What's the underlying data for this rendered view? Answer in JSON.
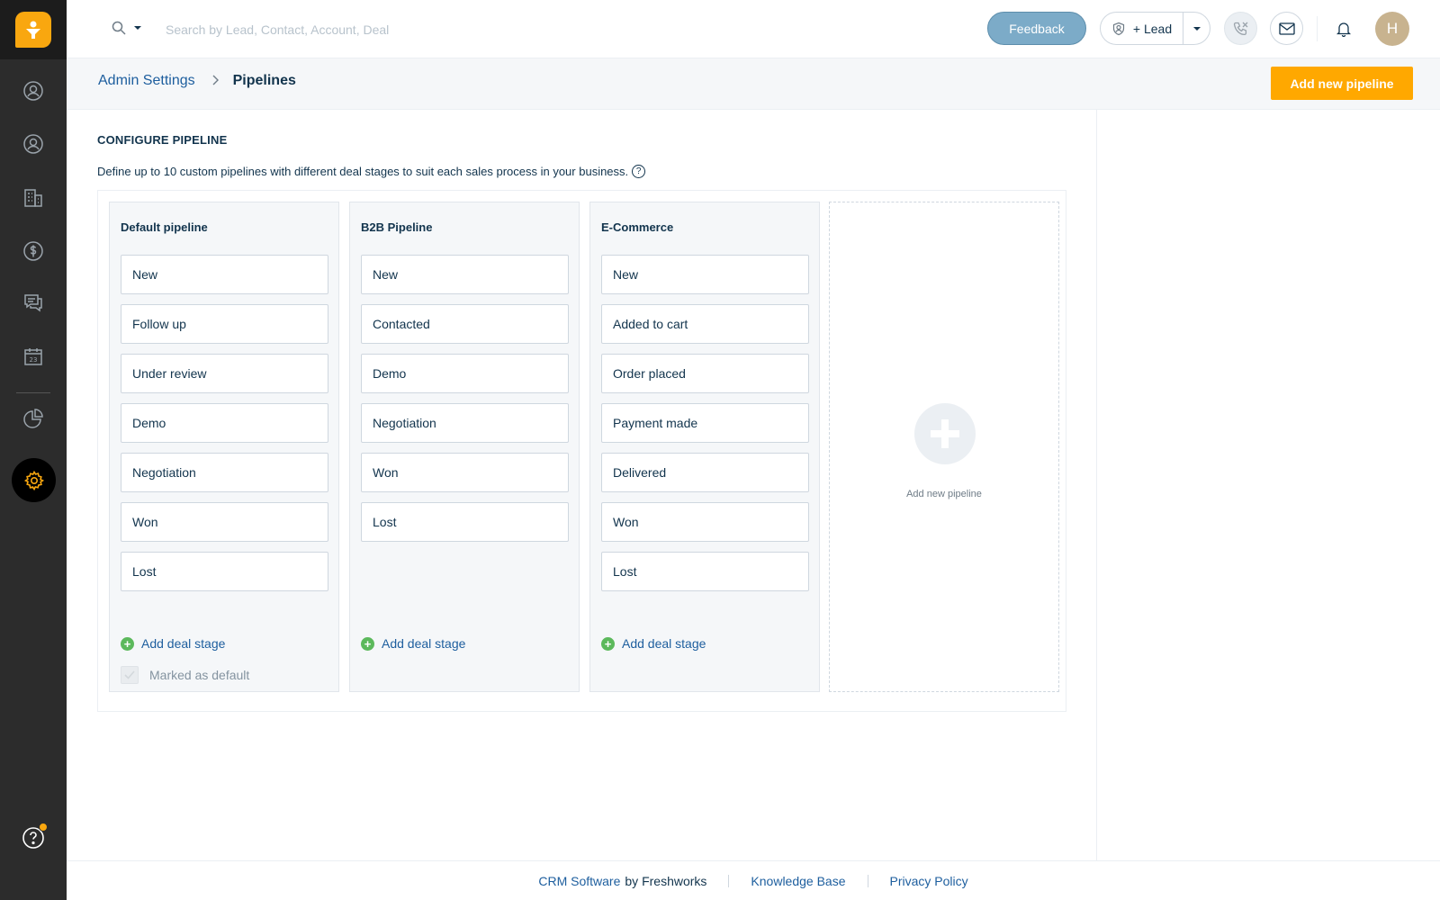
{
  "search": {
    "placeholder": "Search by Lead, Contact, Account, Deal"
  },
  "topbar": {
    "feedback_label": "Feedback",
    "lead_label": "+ Lead",
    "avatar_initial": "H"
  },
  "breadcrumb": {
    "parent": "Admin Settings",
    "current": "Pipelines"
  },
  "header": {
    "add_pipeline_label": "Add new pipeline"
  },
  "section": {
    "title": "CONFIGURE PIPELINE",
    "description": "Define up to 10 custom pipelines with different deal stages to suit each sales process in your business."
  },
  "pipelines": [
    {
      "name": "Default pipeline",
      "stages": [
        "New",
        "Follow up",
        "Under review",
        "Demo",
        "Negotiation",
        "Won",
        "Lost"
      ],
      "add_stage_label": "Add deal stage",
      "default_label": "Marked as default"
    },
    {
      "name": "B2B Pipeline",
      "stages": [
        "New",
        "Contacted",
        "Demo",
        "Negotiation",
        "Won",
        "Lost"
      ],
      "add_stage_label": "Add deal stage"
    },
    {
      "name": "E-Commerce",
      "stages": [
        "New",
        "Added to cart",
        "Order placed",
        "Payment made",
        "Delivered",
        "Won",
        "Lost"
      ],
      "add_stage_label": "Add deal stage"
    }
  ],
  "add_pipeline_card": {
    "label": "Add new pipeline"
  },
  "footer": {
    "crm_link": "CRM Software",
    "by_text": "by Freshworks",
    "kb_link": "Knowledge Base",
    "privacy_link": "Privacy Policy"
  },
  "colors": {
    "accent": "#ffa800",
    "sidebar": "#2c2c2c",
    "link": "#1d5e9e",
    "feedback": "#7cabc8",
    "add_stage_plus": "#5cb95c"
  },
  "sidebar": {
    "icons": [
      "contacts-icon",
      "accounts-icon",
      "buildings-icon",
      "deals-dollar-icon",
      "conversations-icon",
      "calendar-icon",
      "reports-icon",
      "settings-gear-icon",
      "help-icon"
    ]
  }
}
